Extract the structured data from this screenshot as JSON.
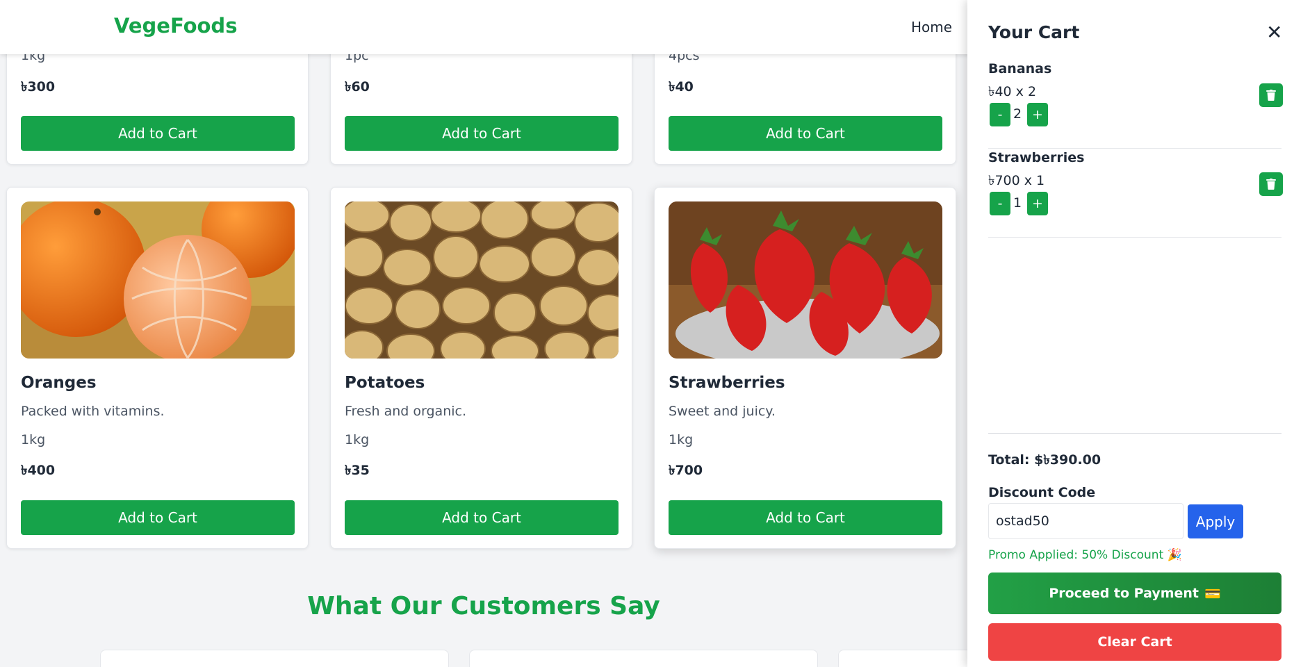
{
  "header": {
    "logo": "VegeFoods",
    "nav_home": "Home"
  },
  "products_top": [
    {
      "unit": "1kg",
      "price": "৳300",
      "button": "Add to Cart"
    },
    {
      "unit": "1pc",
      "price": "৳60",
      "button": "Add to Cart"
    },
    {
      "unit": "4pcs",
      "price": "৳40",
      "button": "Add to Cart"
    }
  ],
  "products": [
    {
      "name": "Oranges",
      "desc": "Packed with vitamins.",
      "unit": "1kg",
      "price": "৳400",
      "button": "Add to Cart"
    },
    {
      "name": "Potatoes",
      "desc": "Fresh and organic.",
      "unit": "1kg",
      "price": "৳35",
      "button": "Add to Cart"
    },
    {
      "name": "Strawberries",
      "desc": "Sweet and juicy.",
      "unit": "1kg",
      "price": "৳700",
      "button": "Add to Cart"
    }
  ],
  "testimonials": {
    "title": "What Our Customers Say"
  },
  "cart": {
    "title": "Your Cart",
    "close": "✕",
    "items": [
      {
        "name": "Bananas",
        "price_line": "৳40 x 2",
        "qty": "2",
        "minus": "-",
        "plus": "+"
      },
      {
        "name": "Strawberries",
        "price_line": "৳700 x 1",
        "qty": "1",
        "minus": "-",
        "plus": "+"
      }
    ],
    "total": "Total: $৳390.00",
    "discount_label": "Discount Code",
    "discount_value": "ostad50",
    "apply": "Apply",
    "promo": "Promo Applied: 50% Discount 🎉",
    "pay": "Proceed to Payment",
    "pay_icon": "💳",
    "clear": "Clear Cart"
  }
}
